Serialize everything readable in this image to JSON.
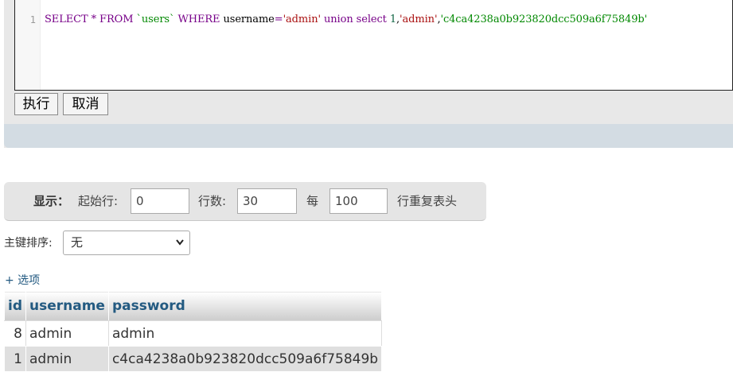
{
  "editor": {
    "line_number": "1",
    "sql_tokens": [
      {
        "cls": "kw",
        "text": "SELECT"
      },
      {
        "cls": "plain",
        "text": " "
      },
      {
        "cls": "op",
        "text": "*"
      },
      {
        "cls": "plain",
        "text": " "
      },
      {
        "cls": "kw",
        "text": "FROM"
      },
      {
        "cls": "plain",
        "text": " "
      },
      {
        "cls": "str2",
        "text": "`users`"
      },
      {
        "cls": "plain",
        "text": " "
      },
      {
        "cls": "kw",
        "text": "WHERE"
      },
      {
        "cls": "plain",
        "text": " username"
      },
      {
        "cls": "op",
        "text": "="
      },
      {
        "cls": "str",
        "text": "'admin'"
      },
      {
        "cls": "plain",
        "text": " "
      },
      {
        "cls": "kw",
        "text": "union"
      },
      {
        "cls": "plain",
        "text": " "
      },
      {
        "cls": "kw",
        "text": "select"
      },
      {
        "cls": "plain",
        "text": " "
      },
      {
        "cls": "num",
        "text": "1"
      },
      {
        "cls": "plain",
        "text": ","
      },
      {
        "cls": "str",
        "text": "'admin'"
      },
      {
        "cls": "plain",
        "text": ","
      },
      {
        "cls": "str2",
        "text": "'c4ca4238a0b923820dcc509a6f75849b'"
      }
    ],
    "execute_label": "执行",
    "cancel_label": "取消"
  },
  "navigation": {
    "show_label": "显示：",
    "start_row_label": "起始行:",
    "start_row_value": "0",
    "row_count_label": "行数:",
    "row_count_value": "30",
    "every_label": "每",
    "repeat_value": "100",
    "repeat_suffix": "行重复表头"
  },
  "sort": {
    "label": "主键排序:",
    "selected": "无"
  },
  "options_link": "+ 选项",
  "results": {
    "columns": [
      "id",
      "username",
      "password"
    ],
    "rows": [
      [
        "8",
        "admin",
        "admin"
      ],
      [
        "1",
        "admin",
        "c4ca4238a0b923820dcc509a6f75849b"
      ]
    ]
  },
  "colors": {
    "link": "#235a81",
    "header_bg": "#cccccc",
    "even_row_bg": "#dfdfdf"
  }
}
